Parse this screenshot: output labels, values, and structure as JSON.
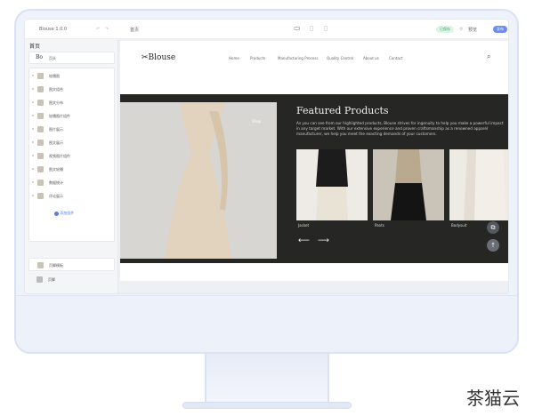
{
  "app": {
    "title": "Blouse 1.0.0",
    "page_select": "首页",
    "status_badge": "已保存",
    "preview_label": "预览",
    "publish_label": "发布"
  },
  "sidebar": {
    "title": "首页",
    "items": [
      {
        "label": "页头"
      },
      {
        "label": "轮播图"
      },
      {
        "label": "图文组合"
      },
      {
        "label": "图文分布"
      },
      {
        "label": "轮播图片组件"
      },
      {
        "label": "图片展示"
      },
      {
        "label": "图文展示"
      },
      {
        "label": "视频图片组件"
      },
      {
        "label": "图文轮播"
      },
      {
        "label": "数据统计"
      },
      {
        "label": "评论展示"
      }
    ],
    "add_label": "添加组件",
    "footer_items": [
      {
        "label": "页脚模板"
      },
      {
        "label": "页脚"
      }
    ]
  },
  "site": {
    "logo": "Blouse",
    "nav": [
      "Home",
      "Products",
      "Manufacturing Process",
      "Quality Control",
      "About us",
      "Contact"
    ],
    "featured": {
      "title": "Featured Products",
      "description": "As you can see from our highlighted products, Blouse strives for ingenuity to help you make a powerful impact in any target market. With our extensive experience and proven craftsmanship as a renowned apparel manufacturer, we help you meet the exacting demands of your customers.",
      "hero_caption": "Shop",
      "products": [
        {
          "label": "Jacket"
        },
        {
          "label": "Pants"
        },
        {
          "label": "Bodysuit"
        }
      ]
    }
  },
  "watermark": "茶猫云"
}
